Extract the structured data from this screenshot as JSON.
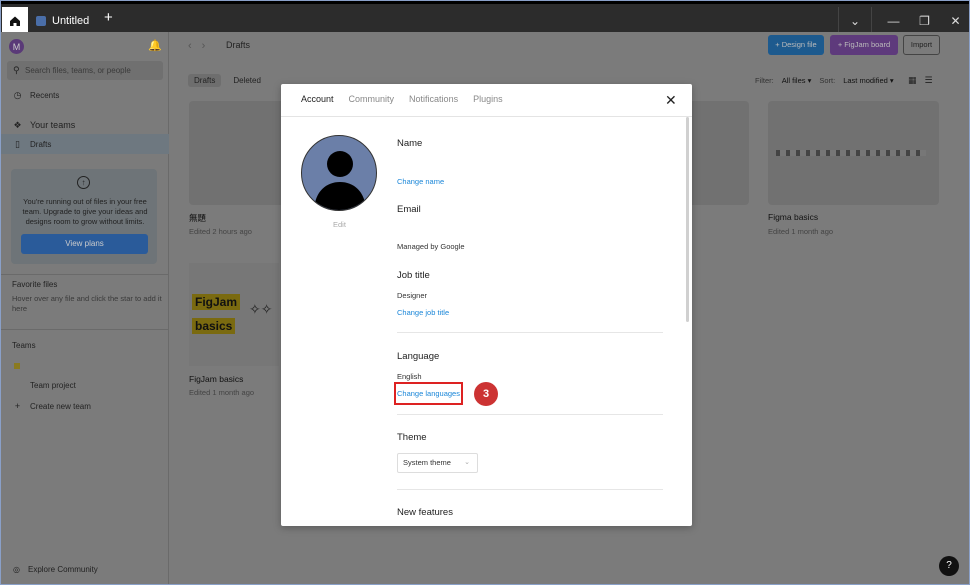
{
  "titlebar": {
    "tab_title": "Untitled",
    "new_tab": "+",
    "controls": [
      "⌄",
      "—",
      "❐",
      "✕"
    ]
  },
  "sidebar": {
    "avatar_initial": "M",
    "search_placeholder": "Search files, teams, or people",
    "recents": "Recents",
    "your_teams": "Your teams",
    "drafts": "Drafts",
    "promo_text": "You're running out of files in your free team. Upgrade to give your ideas and designs room to grow without limits.",
    "promo_button": "View plans",
    "favorite_files": "Favorite files",
    "favorite_hint": "Hover over any file and click the star to add it here",
    "teams": "Teams",
    "team_project": "Team project",
    "create_team": "Create new team",
    "explore_community": "Explore Community"
  },
  "header": {
    "breadcrumb": "Drafts",
    "design_file": "+ Design file",
    "figjam_board": "+ FigJam board",
    "import": "Import"
  },
  "subtabs": [
    "Drafts",
    "Deleted"
  ],
  "filters": {
    "filter_label": "Filter:",
    "filter_value": "All files ▾",
    "sort_label": "Sort:",
    "sort_value": "Last modified ▾"
  },
  "files": [
    {
      "title": "無題",
      "subtitle": "Edited 2 hours ago"
    },
    {
      "title": "Figma basics",
      "subtitle": "Edited 1 month ago"
    },
    {
      "title": "FigJam basics",
      "subtitle": "Edited 1 month ago"
    }
  ],
  "figjam_thumb": {
    "word1": "FigJam",
    "word2": "basics"
  },
  "modal": {
    "tabs": [
      "Account",
      "Community",
      "Notifications",
      "Plugins"
    ],
    "close": "✕",
    "edit": "Edit",
    "name_title": "Name",
    "change_name": "Change name",
    "email_title": "Email",
    "email_value": "Managed by Google",
    "job_title": "Job title",
    "job_value": "Designer",
    "change_job_title": "Change job title",
    "language_title": "Language",
    "language_value": "English",
    "change_languages": "Change languages",
    "step_number": "3",
    "theme_title": "Theme",
    "theme_value": "System theme",
    "new_features": "New features"
  },
  "help": "?"
}
